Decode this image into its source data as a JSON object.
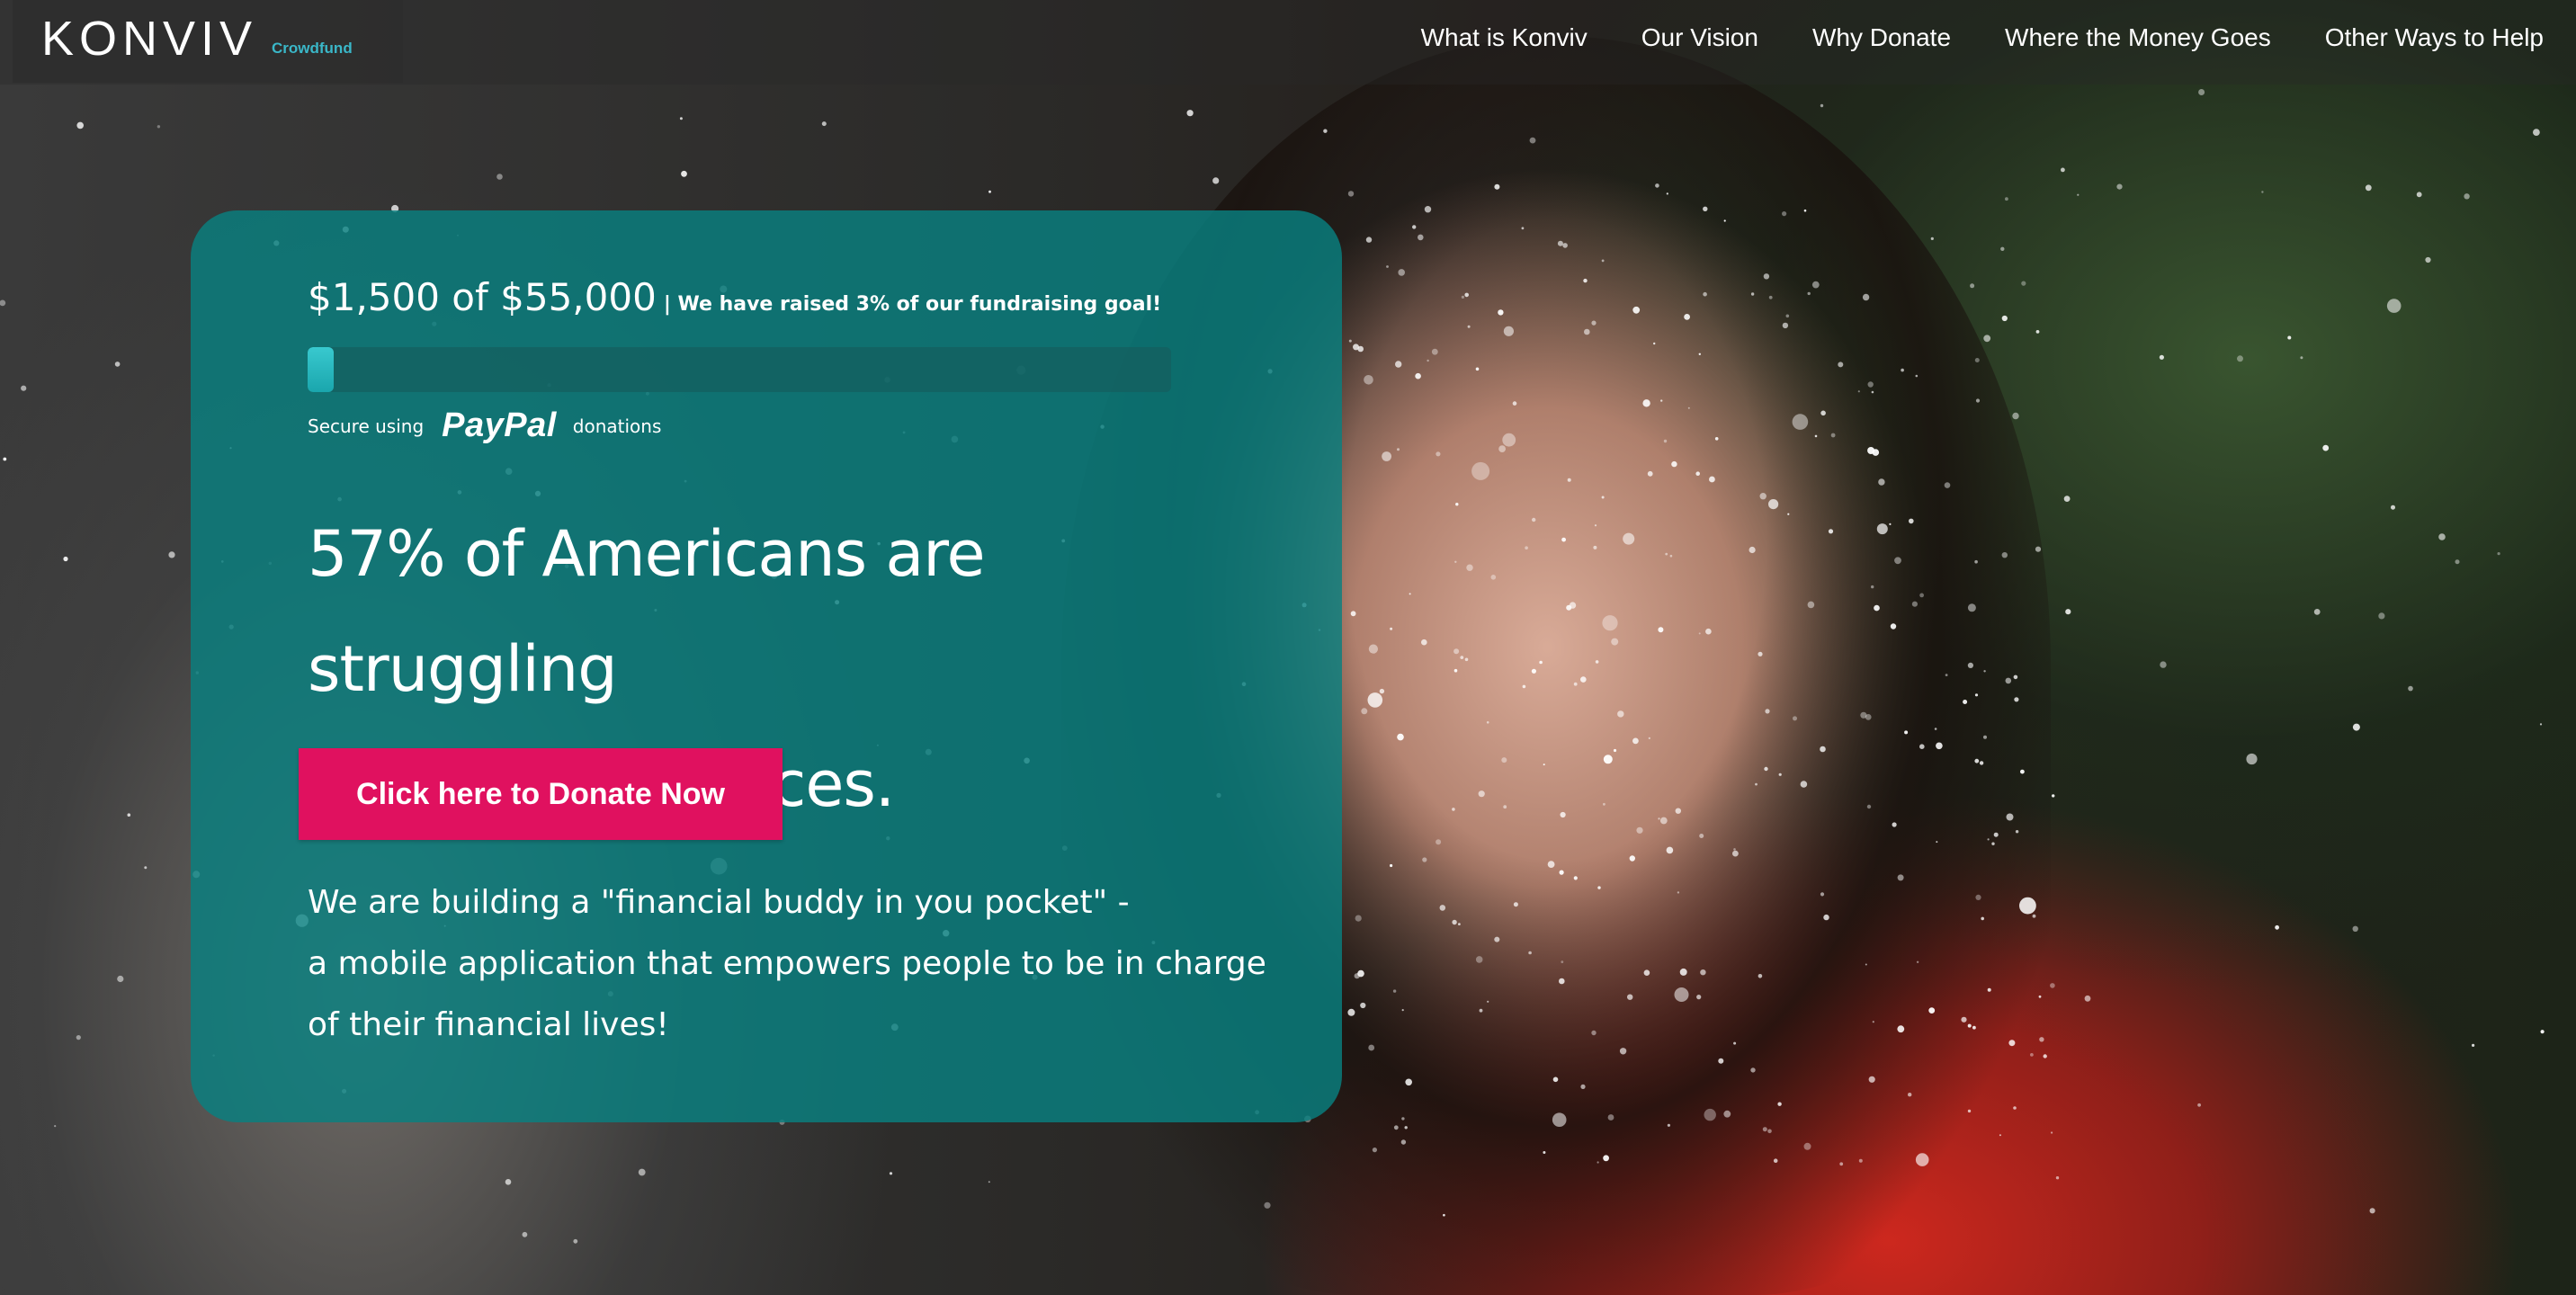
{
  "nav": {
    "logo": "KONVIV",
    "logo_sub": "Crowdfund",
    "links": [
      "What is Konviv",
      "Our Vision",
      "Why Donate",
      "Where the Money Goes",
      "Other Ways to Help"
    ]
  },
  "fundraising": {
    "amount_text": "$1,500 of $55,000",
    "note": "| We have raised 3% of our fundraising goal!",
    "progress_percent": 3,
    "secure_prefix": "Secure using",
    "paypal_brand": "PayPal",
    "secure_suffix": "donations"
  },
  "hero": {
    "headline_line1": "57% of Americans are struggling",
    "headline_line2": "with their finances.",
    "donate_button": "Click here to Donate Now",
    "description_lines": [
      "We are building a \"financial buddy in you pocket\" -",
      "a mobile application that empowers people to be in charge",
      "of their financial lives!"
    ]
  },
  "colors": {
    "card_bg": "#088080",
    "donate_button": "#e0115f",
    "logo_sub": "#3ab7c8",
    "progress_fill": "#39c9cf"
  }
}
